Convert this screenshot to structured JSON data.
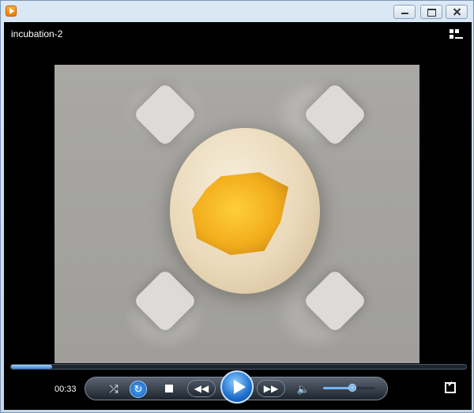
{
  "window": {
    "icon": "media-player-icon"
  },
  "video": {
    "title": "incubation-2"
  },
  "playback": {
    "time": "00:33",
    "progress": 0.09,
    "volume": 0.56
  },
  "icons": {
    "shuffle": "⤮",
    "repeat": "↻",
    "previous": "◀◀",
    "next": "▶▶",
    "volume": "🔈"
  },
  "colors": {
    "accent": "#3a86d6",
    "player_bg": "#000000"
  }
}
